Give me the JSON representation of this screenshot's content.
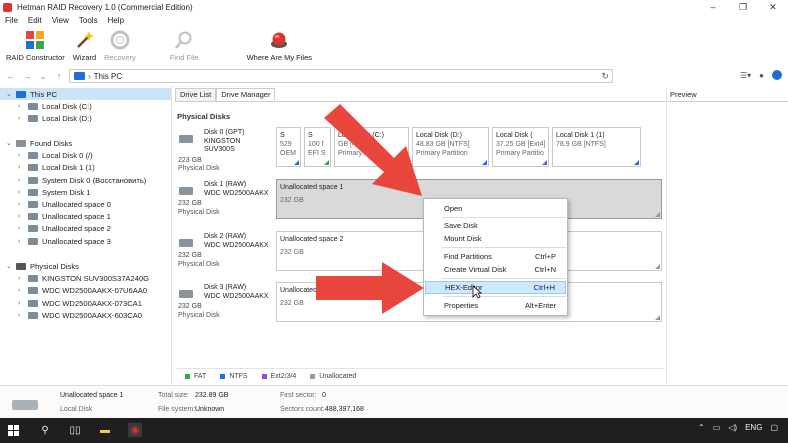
{
  "window": {
    "title": "Hetman RAID Recovery 1.0 (Commercial Edition)",
    "controls": [
      "–",
      "❒",
      "✕"
    ]
  },
  "menu": [
    "File",
    "Edit",
    "View",
    "Tools",
    "Help"
  ],
  "toolbar": {
    "raid_constructor": "RAID Constructor",
    "wizard": "Wizard",
    "recovery": "Recovery",
    "find_file": "Find File",
    "where_files": "Where Are My Files"
  },
  "address": {
    "path": "This PC"
  },
  "tree": {
    "this_pc": "This PC",
    "local_c": "Local Disk (C:)",
    "local_d": "Local Disk (D:)",
    "found_disks": "Found Disks",
    "found": [
      "Local Disk 0 (/)",
      "Local Disk 1 (1)",
      "System Disk 0 (Восстановить)",
      "System Disk 1",
      "Unallocated space 0",
      "Unallocated space 1",
      "Unallocated space 2",
      "Unallocated space 3"
    ],
    "physical_disks": "Physical Disks",
    "physical": [
      "KINGSTON SUV300S37A240G",
      "WDC WD2500AAKX-07U6AA0",
      "WDC WD2500AAKX-073CA1",
      "WDC WD2500AAKX-603CA0"
    ]
  },
  "tabs": {
    "drive_list": "Drive List",
    "drive_manager": "Drive Manager"
  },
  "preview_label": "Preview",
  "drive_manager": {
    "title": "Physical Disks",
    "disks": [
      {
        "line1": "Disk 0 (GPT)",
        "line2": "KINGSTON SUV300S",
        "size": "223 GB",
        "type": "Physical Disk",
        "parts": [
          {
            "name": "S",
            "size": "529",
            "type": "OEM"
          },
          {
            "name": "S",
            "size": "100 f",
            "type": "EFI S"
          },
          {
            "name": "Local Disk (C:)",
            "size": "GB [NTFS]",
            "type": "Primary Partitio"
          },
          {
            "name": "Local Disk (D:)",
            "size": "48.83 GB [NTFS]",
            "type": "Primary Partition"
          },
          {
            "name": "Local Disk (",
            "size": "37.25 GB [Ext4]",
            "type": "Primary Partitio"
          },
          {
            "name": "Local Disk 1 (1)",
            "size": "78.9 GB [NTFS]",
            "type": ""
          }
        ]
      },
      {
        "line1": "Disk 1 (RAW)",
        "line2": "WDC WD2500AAKX",
        "size": "232 GB",
        "type": "Physical Disk",
        "part_name": "Unallocated space 1",
        "part_size": "232 GB"
      },
      {
        "line1": "Disk 2 (RAW)",
        "line2": "WDC WD2500AAKX",
        "size": "232 GB",
        "type": "Physical Disk",
        "part_name": "Unallocated space 2",
        "part_size": "232 GB"
      },
      {
        "line1": "Disk 3 (RAW)",
        "line2": "WDC WD2500AAKX",
        "size": "232 GB",
        "type": "Physical Disk",
        "part_name": "Unallocated space 3",
        "part_size": "232 GB"
      }
    ]
  },
  "legend": [
    "FAT",
    "NTFS",
    "Ext2/3/4",
    "Unallocated"
  ],
  "legend_colors": [
    "#3aa649",
    "#1e6fd9",
    "#8b4fc1",
    "#999999"
  ],
  "context_menu": {
    "open": "Open",
    "save_disk": "Save Disk",
    "mount_disk": "Mount Disk",
    "find_partitions": "Find Partitions",
    "find_partitions_key": "Ctrl+P",
    "create_virtual_disk": "Create Virtual Disk",
    "create_virtual_disk_key": "Ctrl+N",
    "hex_editor": "HEX-Editor",
    "hex_editor_key": "Ctrl+H",
    "properties": "Properties",
    "properties_key": "Alt+Enter"
  },
  "status": {
    "name": "Unallocated space 1",
    "kind": "Local Disk",
    "total_size_label": "Total size:",
    "total_size": "232.89 GB",
    "fs_label": "File system:",
    "fs": "Unknown",
    "first_sector_label": "First sector:",
    "first_sector": "0",
    "sectors_label": "Sectors count:",
    "sectors": "488,397,168"
  },
  "taskbar": {
    "lang": "ENG"
  },
  "colors": {
    "accent": "#1e6fd9",
    "arrow": "#e8463c",
    "selection": "#cce4f7"
  }
}
